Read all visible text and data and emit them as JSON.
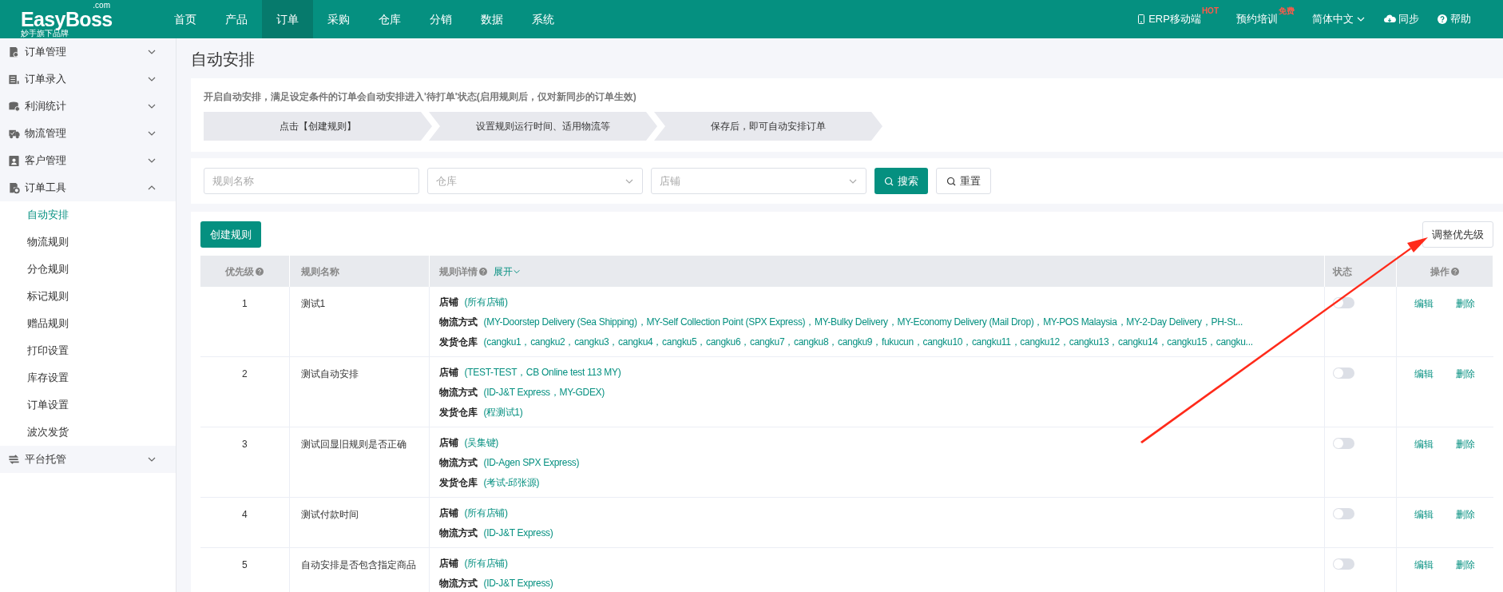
{
  "logo": {
    "name": "EasyBoss",
    "suffix": ".com",
    "tagline": "妙手旗下品牌"
  },
  "nav": [
    {
      "label": "首页",
      "selected": false
    },
    {
      "label": "产品",
      "selected": false
    },
    {
      "label": "订单",
      "selected": true
    },
    {
      "label": "采购",
      "selected": false
    },
    {
      "label": "仓库",
      "selected": false
    },
    {
      "label": "分销",
      "selected": false
    },
    {
      "label": "数据",
      "selected": false
    },
    {
      "label": "系统",
      "selected": false
    }
  ],
  "top_links": [
    {
      "kind": "phone",
      "label": "ERP移动端",
      "badge": "HOT"
    },
    {
      "kind": "plain",
      "label": "预约培训",
      "badge": "免费"
    },
    {
      "kind": "language",
      "label": "简体中文"
    },
    {
      "kind": "sync",
      "label": "同步"
    },
    {
      "kind": "help",
      "label": "帮助"
    }
  ],
  "sidebar": [
    {
      "label": "订单管理",
      "expanded": false
    },
    {
      "label": "订单录入",
      "expanded": false
    },
    {
      "label": "利润统计",
      "expanded": false
    },
    {
      "label": "物流管理",
      "expanded": false
    },
    {
      "label": "客户管理",
      "expanded": false
    },
    {
      "label": "订单工具",
      "expanded": true,
      "children": [
        {
          "label": "自动安排",
          "selected": true
        },
        {
          "label": "物流规则",
          "selected": false
        },
        {
          "label": "分仓规则",
          "selected": false
        },
        {
          "label": "标记规则",
          "selected": false
        },
        {
          "label": "赠品规则",
          "selected": false
        },
        {
          "label": "打印设置",
          "selected": false
        },
        {
          "label": "库存设置",
          "selected": false
        },
        {
          "label": "订单设置",
          "selected": false
        },
        {
          "label": "波次发货",
          "selected": false
        }
      ]
    },
    {
      "label": "平台托管",
      "expanded": false
    }
  ],
  "page_title": "自动安排",
  "intro": "开启自动安排，满足设定条件的订单会自动安排进入'待打单'状态(启用规则后，仅对新同步的订单生效)",
  "steps": [
    "点击【创建规则】",
    "设置规则运行时间、适用物流等",
    "保存后，即可自动安排订单"
  ],
  "filters": {
    "name": {
      "placeholder": "规则名称"
    },
    "warehouse": {
      "placeholder": "仓库"
    },
    "store": {
      "placeholder": "店铺"
    },
    "search_button": "搜索",
    "reset_button": "重置"
  },
  "create_button": "创建规则",
  "priority_button": "调整优先级",
  "table": {
    "columns": {
      "priority": "优先级",
      "name": "规则名称",
      "details": "规则详情",
      "expand": "展开",
      "status": "状态",
      "actions": "操作"
    },
    "rows": [
      {
        "priority": "1",
        "name": "测试1",
        "enabled": false,
        "details": [
          {
            "label": "店铺",
            "value": "(所有店铺)"
          },
          {
            "label": "物流方式",
            "value": "(MY-Doorstep Delivery (Sea Shipping)，MY-Self Collection Point (SPX Express)，MY-Bulky Delivery，MY-Economy Delivery (Mail Drop)，MY-POS Malaysia，MY-2-Day Delivery，PH-St..."
          },
          {
            "label": "发货仓库",
            "value": "(cangku1，cangku2，cangku3，cangku4，cangku5，cangku6，cangku7，cangku8，cangku9，fukucun，cangku10，cangku11，cangku12，cangku13，cangku14，cangku15，cangku..."
          }
        ],
        "actions": [
          "编辑",
          "删除"
        ]
      },
      {
        "priority": "2",
        "name": "测试自动安排",
        "enabled": false,
        "details": [
          {
            "label": "店铺",
            "value": "(TEST-TEST，CB Online test 113 MY)"
          },
          {
            "label": "物流方式",
            "value": "(ID-J&T Express，MY-GDEX)"
          },
          {
            "label": "发货仓库",
            "value": "(程测试1)"
          }
        ],
        "actions": [
          "编辑",
          "删除"
        ]
      },
      {
        "priority": "3",
        "name": "测试回显旧规则是否正确",
        "enabled": false,
        "details": [
          {
            "label": "店铺",
            "value": "(吴集键)"
          },
          {
            "label": "物流方式",
            "value": "(ID-Agen SPX Express)"
          },
          {
            "label": "发货仓库",
            "value": "(考试-邱张源)"
          }
        ],
        "actions": [
          "编辑",
          "删除"
        ]
      },
      {
        "priority": "4",
        "name": "测试付款时间",
        "enabled": false,
        "details": [
          {
            "label": "店铺",
            "value": "(所有店铺)"
          },
          {
            "label": "物流方式",
            "value": "(ID-J&T Express)"
          }
        ],
        "actions": [
          "编辑",
          "删除"
        ]
      },
      {
        "priority": "5",
        "name": "自动安排是否包含指定商品",
        "enabled": false,
        "details": [
          {
            "label": "店铺",
            "value": "(所有店铺)"
          },
          {
            "label": "物流方式",
            "value": "(ID-J&T Express)"
          }
        ],
        "actions": [
          "编辑",
          "删除"
        ]
      }
    ]
  }
}
